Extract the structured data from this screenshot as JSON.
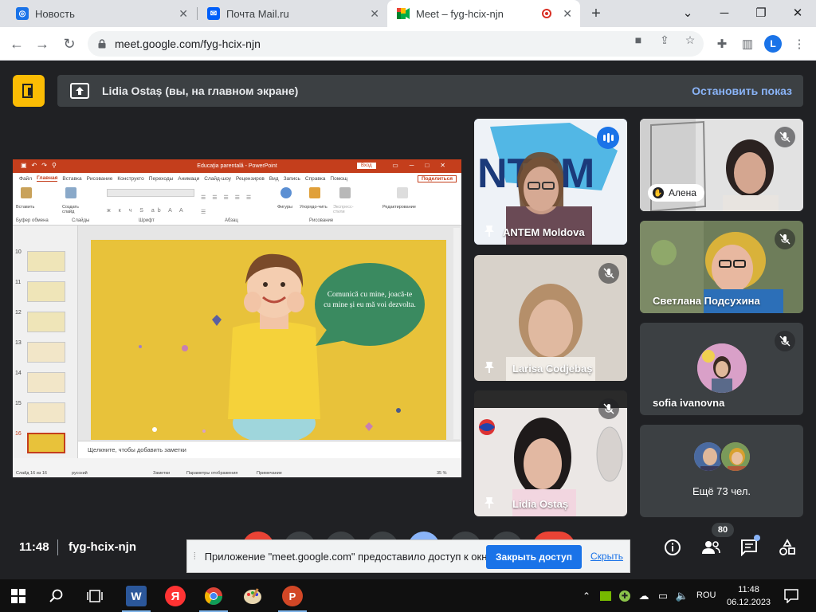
{
  "browser": {
    "tabs": [
      {
        "title": "Новость",
        "favicon": "chrome-news-icon",
        "active": false
      },
      {
        "title": "Почта Mail.ru",
        "favicon": "mail-icon",
        "active": false
      },
      {
        "title": "Meet – fyg-hcix-njn",
        "favicon": "meet-icon",
        "active": true
      }
    ],
    "new_tab_label": "+",
    "url": "meet.google.com/fyg-hcix-njn",
    "profile_initial": "L"
  },
  "meet": {
    "presenting_text": "Lidia Ostaș (вы, на главном экране)",
    "stop_presenting": "Остановить показ",
    "time": "11:48",
    "meeting_code": "fyg-hcix-njn",
    "participant_count": "80",
    "participants": [
      {
        "name": "ANTEM Moldova",
        "speaking": true
      },
      {
        "name": "Алена",
        "hand_raised": true
      },
      {
        "name": "Светлана Подсухина"
      },
      {
        "name": "Larisa Codjebaș"
      },
      {
        "name": "sofia ivanovna"
      },
      {
        "name": "Lidia Ostaș"
      },
      {
        "name": "Ещё 73 чел."
      }
    ]
  },
  "powerpoint": {
    "title": "Educaţia parentală - PowerPoint",
    "signin": "Вход",
    "menu": [
      "Файл",
      "Главная",
      "Вставка",
      "Рисование",
      "Конструкто",
      "Переходы",
      "Анимаци",
      "Слайд-шоу",
      "Рецензиров",
      "Вид",
      "Запись",
      "Справка",
      "Помощ"
    ],
    "share": "Поделиться",
    "ribbon_groups": [
      "Буфер обмена",
      "Слайды",
      "Шрифт",
      "Абзац",
      "Рисование",
      "Редактирование"
    ],
    "ribbon_labels": {
      "paste": "Вставить",
      "new_slide": "Создать слайд",
      "shapes": "Фигуры",
      "arrange": "Упорядо-чить",
      "express": "Экспресс-стили",
      "edit": "Редактирование"
    },
    "thumbnails": [
      "10",
      "11",
      "12",
      "13",
      "14",
      "15",
      "16"
    ],
    "selected_slide": "16",
    "bubble_text": "Comunică cu mine, joacă-te cu mine și eu mă voi dezvolta.",
    "notes_placeholder": "Щелкните, чтобы добавить заметки",
    "status": {
      "slide": "Слайд 16 из 16",
      "lang": "русский",
      "notes": "Заметки",
      "display": "Параметры отображения",
      "comments": "Примечание",
      "zoom": "35 %"
    }
  },
  "share_notice": {
    "message": "Приложение \"meet.google.com\" предоставило доступ к окну.",
    "stop_button": "Закрыть доступ",
    "hide_link": "Скрыть"
  },
  "taskbar": {
    "time": "11:48",
    "date": "06.12.2023",
    "lang": "ROU"
  },
  "colors": {
    "meet_bg": "#202124",
    "tile_bg": "#3c4043",
    "accent_blue": "#8ab4f8",
    "present_yellow": "#fbbc04",
    "ppt_red": "#c43e1c",
    "slide_yellow": "#e8c23a",
    "bubble_green": "#3a8a60"
  }
}
